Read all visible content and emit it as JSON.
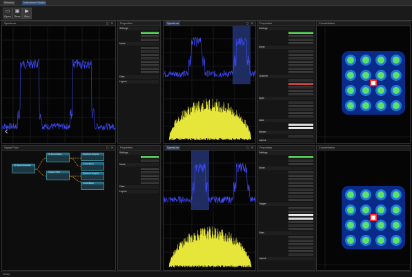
{
  "titlebar": {
    "tabs": [
      "Window",
      "Instrument Studio"
    ]
  },
  "toolbar": {
    "buttons": [
      {
        "label": "Open",
        "icon": "folder-icon"
      },
      {
        "label": "Save",
        "icon": "save-icon"
      },
      {
        "label": "Run",
        "icon": "play-icon"
      },
      {
        "label": "Stop",
        "icon": "stop-icon"
      }
    ]
  },
  "panels": {
    "spectrum_top_left": {
      "title": "Spectrum"
    },
    "flow": {
      "title": "Signal Flow"
    },
    "props_top_left": {
      "title": "Properties",
      "sections": [
        "Settings",
        "Mode",
        "Data",
        "Layout"
      ]
    },
    "props_bottom_left": {
      "title": "Properties",
      "sections": [
        "Settings",
        "Mode",
        "Data",
        "Layout"
      ]
    },
    "spectrum_top_mid": {
      "title": "Spectrum"
    },
    "spectrum_bottom_mid": {
      "title": "Spectrum"
    },
    "props_top_right": {
      "title": "Properties",
      "sections": [
        "Settings",
        "Mode",
        "Channel",
        "Span",
        "Data",
        "Marker",
        "Layout"
      ]
    },
    "props_bottom_right": {
      "title": "Properties",
      "sections": [
        "Settings",
        "Mode",
        "Trigger",
        "Filter",
        "Layout"
      ]
    },
    "constellation_top": {
      "title": "Constellation"
    },
    "constellation_bottom": {
      "title": "Constellation"
    }
  },
  "flow_nodes": [
    {
      "label": "IQ Signal Generator"
    },
    {
      "label": "IQ Demodulator"
    },
    {
      "label": "Spectrum Analyzer"
    },
    {
      "label": "Channel Filter"
    },
    {
      "label": "Spectrum Analyzer"
    },
    {
      "label": "Constellation"
    },
    {
      "label": "Constellation"
    }
  ],
  "colors": {
    "spectrum_trace": "#3f4cff",
    "time_trace": "#e6e63a",
    "constellation_center": "#ff2a2a",
    "accent_green": "#3aa53a"
  },
  "status": {
    "text": "Ready"
  }
}
